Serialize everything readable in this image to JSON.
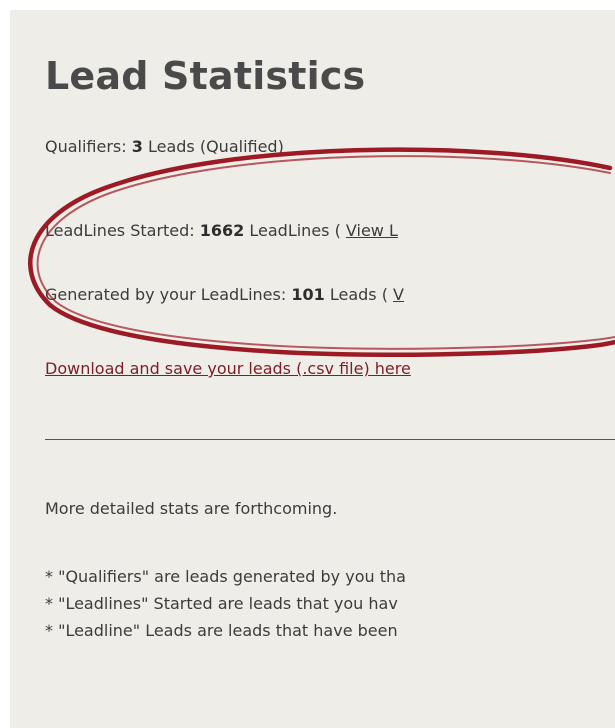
{
  "heading": "Lead Statistics",
  "qualifiers": {
    "label": "Qualifiers: ",
    "count": "3",
    "suffix": " Leads (Qualified)"
  },
  "leadlines_started": {
    "label": "LeadLines Started: ",
    "count": "1662",
    "suffix": " LeadLines ( ",
    "link": "View L"
  },
  "generated": {
    "label": "Generated by your LeadLines: ",
    "count": "101",
    "suffix": " Leads ( ",
    "link": "V"
  },
  "download_link": "Download and save your leads (.csv file) here",
  "more_stats": "More detailed stats are forthcoming.",
  "footnotes": [
    "* \"Qualifiers\" are leads generated by you tha",
    "* \"Leadlines\" Started are leads that you hav",
    "* \"Leadline\" Leads are leads that have been"
  ],
  "colors": {
    "background": "#eeede8",
    "annotation_ellipse": "#9b1a24"
  }
}
